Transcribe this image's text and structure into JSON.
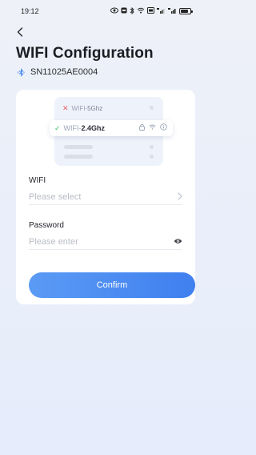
{
  "status_bar": {
    "time": "19:12"
  },
  "header": {
    "title": "WIFI Configuration"
  },
  "device": {
    "serial": "SN11025AE0004",
    "icon": "bluetooth-icon"
  },
  "illustration": {
    "network_rejected_prefix": "WIFI-",
    "network_rejected_band": "5Ghz",
    "network_selected_prefix": "WIFI-",
    "network_selected_band": "2.4Ghz",
    "colors": {
      "reject": "#e0615f",
      "accept": "#3bbf6a"
    }
  },
  "form": {
    "wifi_label": "WIFI",
    "wifi_placeholder": "Please select",
    "password_label": "Password",
    "password_placeholder": "Please enter"
  },
  "confirm_label": "Confirm",
  "colors": {
    "accent": "#4a8cf2"
  }
}
